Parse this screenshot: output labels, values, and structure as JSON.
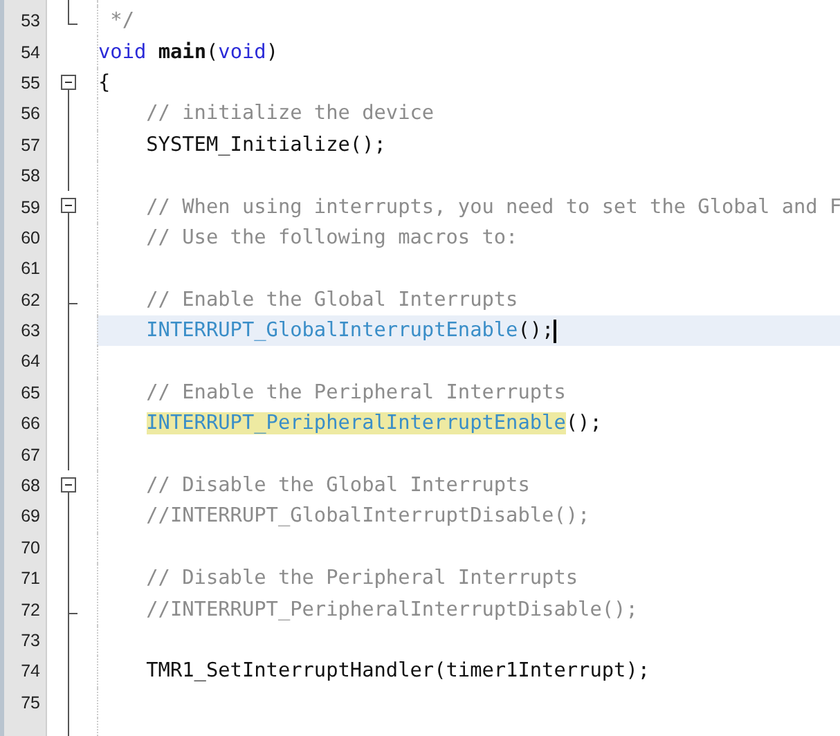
{
  "editor": {
    "lines": [
      {
        "number": "53",
        "kind": "corner",
        "current": false,
        "cursor": false,
        "tokens": [
          {
            "kind": "comment",
            "text": " */"
          }
        ]
      },
      {
        "number": "54",
        "kind": "blank",
        "current": false,
        "cursor": false,
        "tokens": [
          {
            "kind": "keyword",
            "text": "void "
          },
          {
            "kind": "function",
            "text": "main"
          },
          {
            "kind": "plain",
            "text": "("
          },
          {
            "kind": "keyword",
            "text": "void"
          },
          {
            "kind": "plain",
            "text": ")"
          }
        ]
      },
      {
        "number": "55",
        "kind": "open",
        "current": false,
        "cursor": false,
        "tokens": [
          {
            "kind": "plain",
            "text": "{"
          }
        ]
      },
      {
        "number": "56",
        "kind": "line",
        "current": false,
        "cursor": false,
        "indented": true,
        "tokens": [
          {
            "kind": "comment",
            "text": "// initialize the device"
          }
        ]
      },
      {
        "number": "57",
        "kind": "line",
        "current": false,
        "cursor": false,
        "indented": true,
        "tokens": [
          {
            "kind": "plain",
            "text": "SYSTEM_Initialize();"
          }
        ]
      },
      {
        "number": "58",
        "kind": "line",
        "current": false,
        "cursor": false
      },
      {
        "number": "59",
        "kind": "open",
        "current": false,
        "cursor": false,
        "indented": true,
        "tokens": [
          {
            "kind": "comment",
            "text": "// When using interrupts, you need to set the Global and F"
          }
        ]
      },
      {
        "number": "60",
        "kind": "line",
        "current": false,
        "cursor": false,
        "indented": true,
        "tokens": [
          {
            "kind": "comment",
            "text": "// Use the following macros to:"
          }
        ]
      },
      {
        "number": "61",
        "kind": "line",
        "current": false,
        "cursor": false
      },
      {
        "number": "62",
        "kind": "tee",
        "current": false,
        "cursor": false,
        "indented": true,
        "tokens": [
          {
            "kind": "comment",
            "text": "// Enable the Global Interrupts"
          }
        ]
      },
      {
        "number": "63",
        "kind": "line",
        "current": true,
        "cursor": true,
        "indented": true,
        "tokens": [
          {
            "kind": "macro",
            "text": "INTERRUPT_GlobalInterruptEnable"
          },
          {
            "kind": "plain",
            "text": "();"
          }
        ]
      },
      {
        "number": "64",
        "kind": "line",
        "current": false,
        "cursor": false
      },
      {
        "number": "65",
        "kind": "line",
        "current": false,
        "cursor": false,
        "indented": true,
        "tokens": [
          {
            "kind": "comment",
            "text": "// Enable the Peripheral Interrupts"
          }
        ]
      },
      {
        "number": "66",
        "kind": "line",
        "current": false,
        "cursor": false,
        "indented": true,
        "tokens": [
          {
            "kind": "match",
            "text": "INTERRUPT_PeripheralInterruptEnable"
          },
          {
            "kind": "plain",
            "text": "();"
          }
        ]
      },
      {
        "number": "67",
        "kind": "line",
        "current": false,
        "cursor": false
      },
      {
        "number": "68",
        "kind": "open",
        "current": false,
        "cursor": false,
        "indented": true,
        "tokens": [
          {
            "kind": "comment",
            "text": "// Disable the Global Interrupts"
          }
        ]
      },
      {
        "number": "69",
        "kind": "line",
        "current": false,
        "cursor": false,
        "indented": true,
        "tokens": [
          {
            "kind": "comment",
            "text": "//INTERRUPT_GlobalInterruptDisable();"
          }
        ]
      },
      {
        "number": "70",
        "kind": "line",
        "current": false,
        "cursor": false
      },
      {
        "number": "71",
        "kind": "line",
        "current": false,
        "cursor": false,
        "indented": true,
        "tokens": [
          {
            "kind": "comment",
            "text": "// Disable the Peripheral Interrupts"
          }
        ]
      },
      {
        "number": "72",
        "kind": "tee",
        "current": false,
        "cursor": false,
        "indented": true,
        "tokens": [
          {
            "kind": "comment",
            "text": "//INTERRUPT_PeripheralInterruptDisable();"
          }
        ]
      },
      {
        "number": "73",
        "kind": "line",
        "current": false,
        "cursor": false
      },
      {
        "number": "74",
        "kind": "line",
        "current": false,
        "cursor": false,
        "indented": true,
        "tokens": [
          {
            "kind": "plain",
            "text": "TMR1_SetInterruptHandler(timer1Interrupt);"
          }
        ]
      },
      {
        "number": "75",
        "kind": "line",
        "current": false,
        "cursor": false
      }
    ]
  }
}
